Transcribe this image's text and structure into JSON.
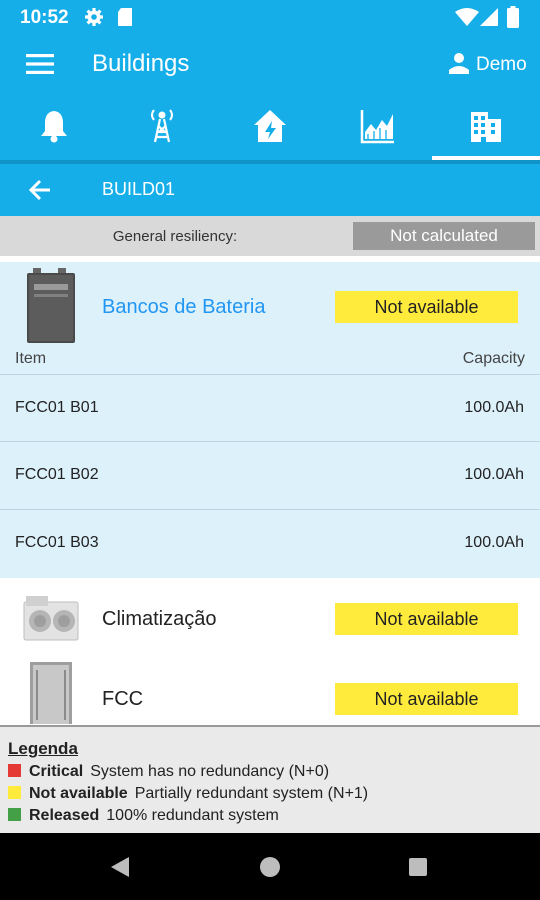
{
  "status_bar": {
    "time": "10:52",
    "icons": [
      "gear-icon",
      "sd-card-icon",
      "wifi-icon",
      "signal-icon",
      "battery-icon"
    ]
  },
  "app_bar": {
    "title": "Buildings",
    "user_label": "Demo",
    "menu_icon": "hamburger-icon",
    "user_icon": "person-icon"
  },
  "tabs": [
    {
      "icon": "bell-icon",
      "selected": false
    },
    {
      "icon": "antenna-tower-icon",
      "selected": false
    },
    {
      "icon": "house-power-icon",
      "selected": false
    },
    {
      "icon": "area-chart-icon",
      "selected": false
    },
    {
      "icon": "building-icon",
      "selected": true
    }
  ],
  "subheader": {
    "title": "BUILD01",
    "back_icon": "arrow-left-icon"
  },
  "resiliency": {
    "label": "General resiliency:",
    "value": "Not calculated"
  },
  "systems": [
    {
      "name": "Bancos de Bateria",
      "status": "Not available",
      "icon": "battery-bank-image",
      "expanded": true,
      "columns": {
        "item": "Item",
        "capacity": "Capacity"
      },
      "rows": [
        {
          "item": "FCC01 B01",
          "capacity": "100.0Ah"
        },
        {
          "item": "FCC01 B02",
          "capacity": "100.0Ah"
        },
        {
          "item": "FCC01 B03",
          "capacity": "100.0Ah"
        }
      ]
    },
    {
      "name": "Climatização",
      "status": "Not available",
      "icon": "air-conditioner-image",
      "expanded": false
    },
    {
      "name": "FCC",
      "status": "Not available",
      "icon": "fcc-cabinet-image",
      "expanded": false
    }
  ],
  "legend": {
    "title": "Legenda",
    "items": [
      {
        "label": "Critical",
        "description": "System has no redundancy (N+0)",
        "color": "#e53935"
      },
      {
        "label": "Not available",
        "description": "Partially redundant system (N+1)",
        "color": "#ffeb3b"
      },
      {
        "label": "Released",
        "description": "100% redundant system",
        "color": "#43a047"
      }
    ]
  },
  "colors": {
    "primary": "#16aee8",
    "status_warning": "#ffeb3b",
    "link": "#2196f3",
    "not_calculated": "#9a9a9a"
  },
  "nav_bar": {
    "icons": [
      "back-triangle-icon",
      "home-circle-icon",
      "recents-square-icon"
    ]
  }
}
